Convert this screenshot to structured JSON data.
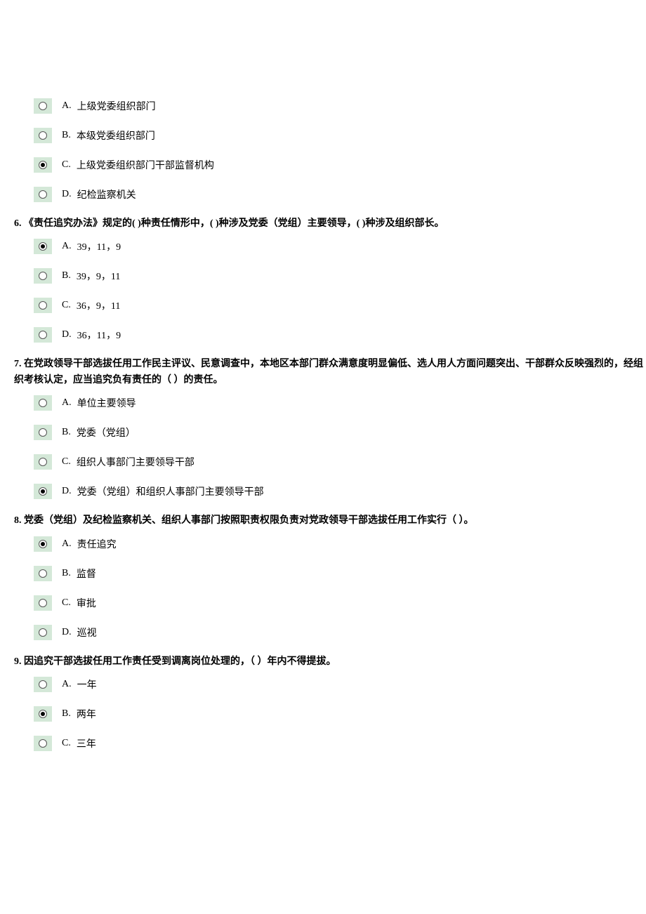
{
  "questions": [
    {
      "number": "",
      "text": "",
      "options": [
        {
          "letter": "A.",
          "text": "上级党委组织部门",
          "selected": false
        },
        {
          "letter": "B.",
          "text": "本级党委组织部门",
          "selected": false
        },
        {
          "letter": "C.",
          "text": "上级党委组织部门干部监督机构",
          "selected": true
        },
        {
          "letter": "D.",
          "text": "纪检监察机关",
          "selected": false
        }
      ]
    },
    {
      "number": "6.",
      "text": "《责任追究办法》规定的( )种责任情形中，( )种涉及党委（党组）主要领导，( )种涉及组织部长。",
      "options": [
        {
          "letter": "A.",
          "text": "39，11，9",
          "selected": true
        },
        {
          "letter": "B.",
          "text": "39，9，11",
          "selected": false
        },
        {
          "letter": "C.",
          "text": "36，9，11",
          "selected": false
        },
        {
          "letter": "D.",
          "text": "36，11，9",
          "selected": false
        }
      ]
    },
    {
      "number": "7.",
      "text": "在党政领导干部选拔任用工作民主评议、民意调查中，本地区本部门群众满意度明显偏低、选人用人方面问题突出、干部群众反映强烈的，经组织考核认定，应当追究负有责任的（ ）的责任。",
      "options": [
        {
          "letter": "A.",
          "text": "单位主要领导",
          "selected": false
        },
        {
          "letter": "B.",
          "text": "党委（党组）",
          "selected": false
        },
        {
          "letter": "C.",
          "text": "组织人事部门主要领导干部",
          "selected": false
        },
        {
          "letter": "D.",
          "text": "党委（党组）和组织人事部门主要领导干部",
          "selected": true
        }
      ]
    },
    {
      "number": "8.",
      "text": "党委（党组）及纪检监察机关、组织人事部门按照职责权限负责对党政领导干部选拔任用工作实行（ ）。",
      "options": [
        {
          "letter": "A.",
          "text": "责任追究",
          "selected": true
        },
        {
          "letter": "B.",
          "text": "监督",
          "selected": false
        },
        {
          "letter": "C.",
          "text": "审批",
          "selected": false
        },
        {
          "letter": "D.",
          "text": "巡视",
          "selected": false
        }
      ]
    },
    {
      "number": "9.",
      "text": "因追究干部选拔任用工作责任受到调离岗位处理的，（ ）年内不得提拔。",
      "options": [
        {
          "letter": "A.",
          "text": "一年",
          "selected": false
        },
        {
          "letter": "B.",
          "text": "两年",
          "selected": true
        },
        {
          "letter": "C.",
          "text": "三年",
          "selected": false
        }
      ]
    }
  ]
}
